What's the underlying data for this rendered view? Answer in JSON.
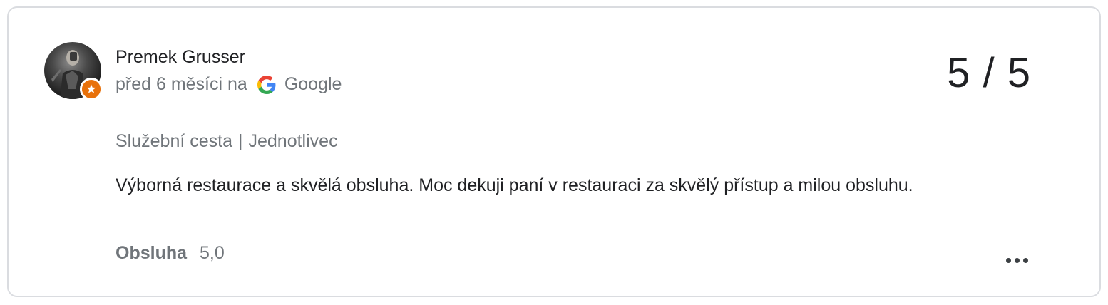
{
  "review": {
    "author": "Premek Grusser",
    "time_ago": "před 6 měsíci na",
    "source": "Google",
    "score": "5 / 5",
    "trip_type": "Služební cesta",
    "separator": "|",
    "traveler_type": "Jednotlivec",
    "text": "Výborná restaurace a skvělá obsluha. Moc dekuji paní v restauraci za skvělý přístup a milou obsluhu.",
    "ratings": [
      {
        "label": "Obsluha",
        "value": "5,0"
      }
    ]
  },
  "icons": {
    "avatar": "user-avatar-photo",
    "badge": "local-guide-star-icon",
    "source": "google-g-icon",
    "more": "more-options-icon"
  },
  "colors": {
    "border": "#dadce0",
    "primary_text": "#202124",
    "secondary_text": "#70757a",
    "badge": "#e8710a"
  }
}
